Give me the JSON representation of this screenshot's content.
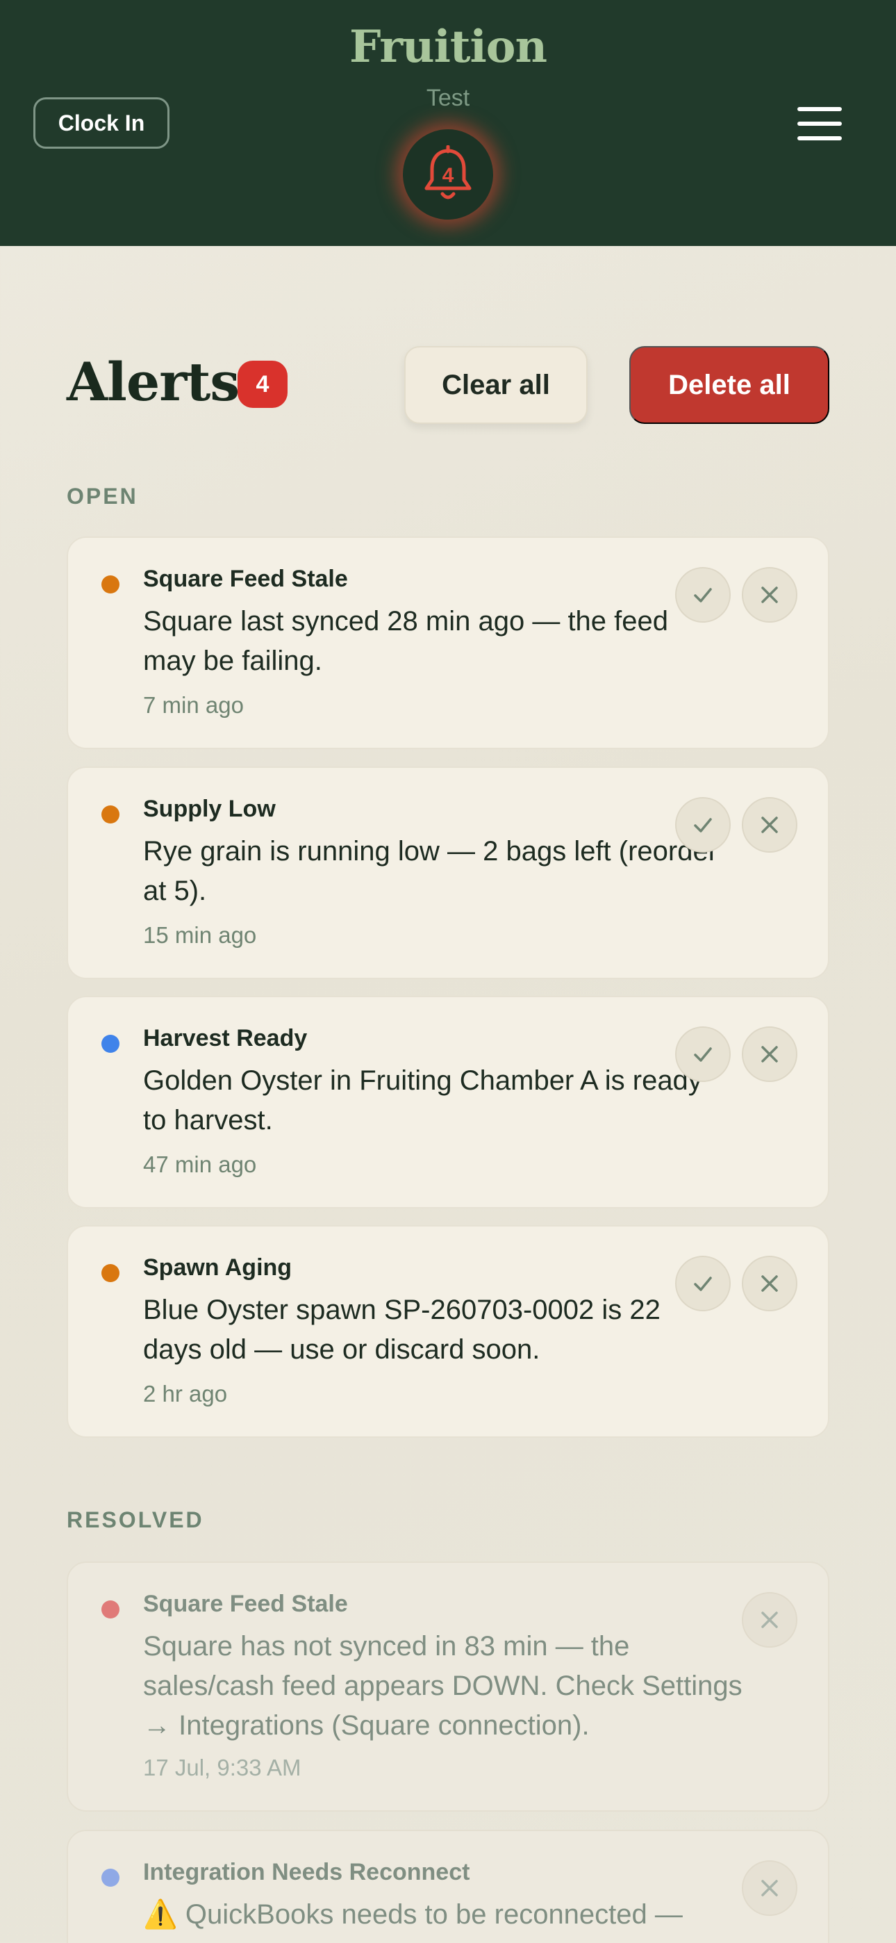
{
  "header": {
    "brand": "Fruition",
    "tenant": "Test",
    "clock_in_label": "Clock In",
    "bell_count": "4",
    "bell_color": "#e24a3a",
    "menu_icon": "hamburger-menu-icon"
  },
  "page": {
    "title": "Alerts",
    "count": "4",
    "clear_all_label": "Clear all",
    "delete_all_label": "Delete all"
  },
  "colors": {
    "header_bg": "#213a2b",
    "brand": "#a8c59b",
    "danger": "#c0382f",
    "warning_dot": "#d9770f",
    "info_dot": "#3f83ea",
    "resolved_warning_dot": "#e07a78",
    "resolved_info_dot": "#8fa9e6"
  },
  "sections": {
    "open_label": "OPEN",
    "resolved_label": "RESOLVED"
  },
  "open_alerts": [
    {
      "title": "Square Feed Stale",
      "message": "Square last synced 28 min ago — the feed may be failing.",
      "time": "7 min ago",
      "severity": "warning"
    },
    {
      "title": "Supply Low",
      "message": "Rye grain is running low — 2 bags left (reorder at 5).",
      "time": "15 min ago",
      "severity": "warning"
    },
    {
      "title": "Harvest Ready",
      "message": "Golden Oyster in Fruiting Chamber A is ready to harvest.",
      "time": "47 min ago",
      "severity": "info"
    },
    {
      "title": "Spawn Aging",
      "message": "Blue Oyster spawn SP-260703-0002 is 22 days old — use or discard soon.",
      "time": "2 hr ago",
      "severity": "warning"
    }
  ],
  "resolved_alerts": [
    {
      "title": "Square Feed Stale",
      "message": "Square has not synced in 83 min — the sales/cash feed appears DOWN. Check Settings → Integrations (Square connection).",
      "time": "17 Jul, 9:33 AM",
      "severity": "critical"
    },
    {
      "title": "Integration Needs Reconnect",
      "message": "⚠️ QuickBooks needs to be reconnected —",
      "severity": "info"
    }
  ]
}
